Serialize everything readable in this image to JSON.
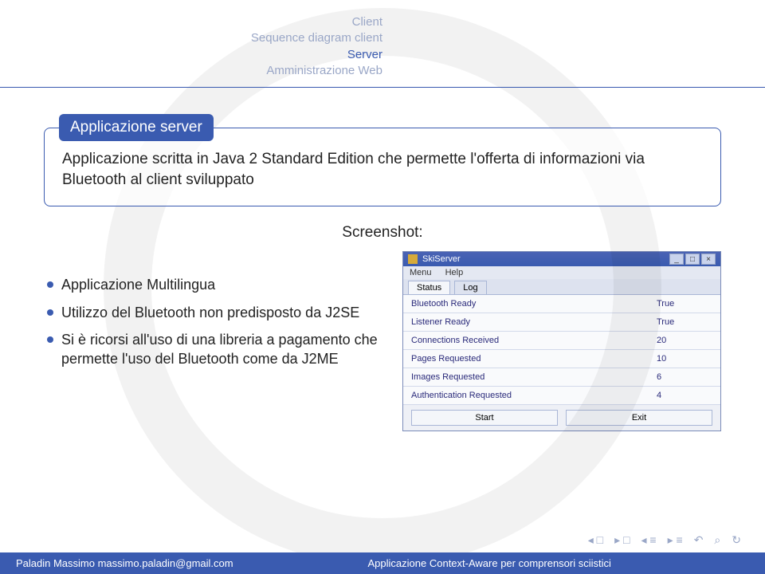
{
  "header": {
    "nav": [
      "Client",
      "Sequence diagram client",
      "Server",
      "Amministrazione Web"
    ],
    "active_index": 2,
    "subnav": ""
  },
  "block": {
    "title": "Applicazione server",
    "body": "Applicazione scritta in Java 2 Standard Edition che permette l'offerta di informazioni via Bluetooth al client sviluppato"
  },
  "screenshot_label": "Screenshot:",
  "bullets": [
    "Applicazione Multilingua",
    "Utilizzo del Bluetooth non predisposto da J2SE",
    "Si è ricorsi all'uso di una libreria a pagamento che permette l'uso del Bluetooth come da J2ME"
  ],
  "app": {
    "title": "SkiServer",
    "menu": [
      "Menu",
      "Help"
    ],
    "tabs": [
      "Status",
      "Log"
    ],
    "active_tab": 0,
    "rows": [
      {
        "label": "Bluetooth Ready",
        "value": "True"
      },
      {
        "label": "Listener Ready",
        "value": "True"
      },
      {
        "label": "Connections Received",
        "value": "20"
      },
      {
        "label": "Pages Requested",
        "value": "10"
      },
      {
        "label": "Images Requested",
        "value": "6"
      },
      {
        "label": "Authentication Requested",
        "value": "4"
      }
    ],
    "buttons": {
      "start": "Start",
      "exit": "Exit"
    },
    "window_controls": {
      "min": "_",
      "max": "□",
      "close": "×"
    }
  },
  "footer": {
    "author": "Paladin Massimo massimo.paladin@gmail.com",
    "title": "Applicazione Context-Aware per comprensori sciistici"
  }
}
